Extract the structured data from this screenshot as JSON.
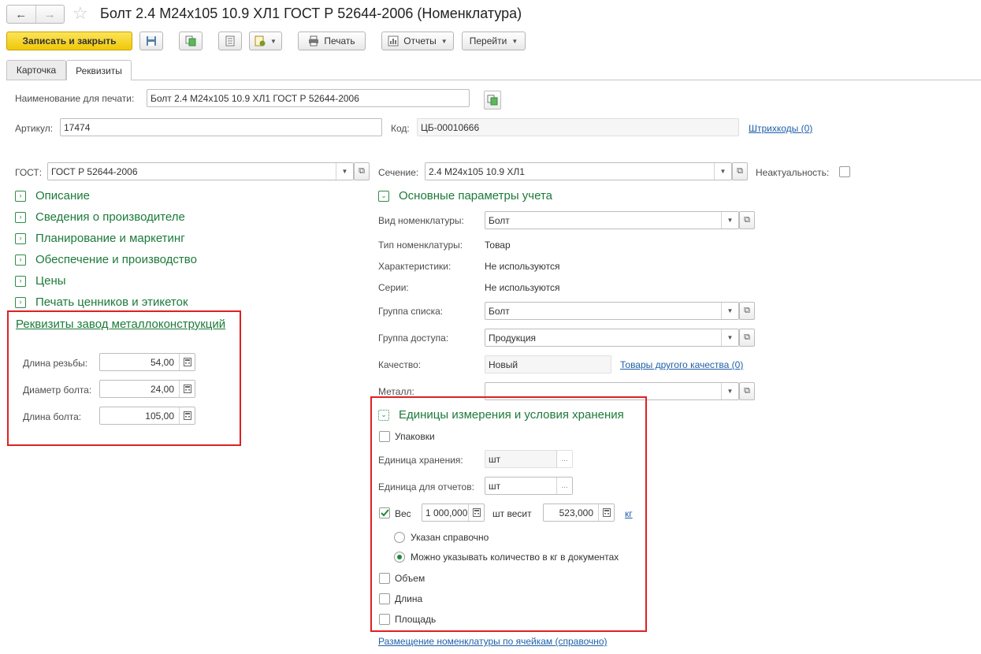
{
  "window": {
    "title": "Болт 2.4 М24х105 10.9 ХЛ1 ГОСТ Р 52644-2006 (Номенклатура)",
    "back_icon": "arrow-left-icon",
    "forward_icon": "arrow-right-icon",
    "favorite_icon": "star-icon"
  },
  "toolbar": {
    "save_close": "Записать и закрыть",
    "print": "Печать",
    "reports": "Отчеты",
    "goto": "Перейти"
  },
  "tabs": [
    "Карточка",
    "Реквизиты"
  ],
  "fields": {
    "print_name_label": "Наименование для печати:",
    "print_name_value": "Болт 2.4 М24х105 10.9 ХЛ1 ГОСТ Р 52644-2006",
    "article_label": "Артикул:",
    "article_value": "17474",
    "code_label": "Код:",
    "code_value": "ЦБ-00010666",
    "barcodes_link": "Штрихкоды (0)",
    "gost_label": "ГОСТ:",
    "gost_value": "ГОСТ Р 52644-2006",
    "section_label": "Сечение:",
    "section_value": "2.4 М24х105 10.9 ХЛ1",
    "irrelevance_label": "Неактуальность:"
  },
  "left_groups": [
    "Описание",
    "Сведения о производителе",
    "Планирование и маркетинг",
    "Обеспечение и производство",
    "Цены",
    "Печать ценников и этикеток"
  ],
  "plant_requisites": {
    "title": "Реквизиты завод металлоконструкций",
    "thread_length_label": "Длина резьбы:",
    "thread_length_value": "54,00",
    "bolt_diameter_label": "Диаметр болта:",
    "bolt_diameter_value": "24,00",
    "bolt_length_label": "Длина болта:",
    "bolt_length_value": "105,00"
  },
  "main_params": {
    "title": "Основные параметры учета",
    "kind_label": "Вид номенклатуры:",
    "kind_value": "Болт",
    "type_label": "Тип номенклатуры:",
    "type_value": "Товар",
    "characteristics_label": "Характеристики:",
    "characteristics_value": "Не используются",
    "series_label": "Серии:",
    "series_value": "Не используются",
    "list_group_label": "Группа списка:",
    "list_group_value": "Болт",
    "access_group_label": "Группа доступа:",
    "access_group_value": "Продукция",
    "quality_label": "Качество:",
    "quality_value": "Новый",
    "other_quality_link": "Товары другого качества (0)",
    "metal_label": "Металл:",
    "metal_value": ""
  },
  "units": {
    "title": "Единицы измерения и условия хранения",
    "packages_label": "Упаковки",
    "storage_unit_label": "Единица хранения:",
    "storage_unit_value": "шт",
    "report_unit_label": "Единица для отчетов:",
    "report_unit_value": "шт",
    "weight_label": "Вес",
    "weight_qty_value": "1 000,000",
    "weighs_label": "шт весит",
    "weight_value": "523,000",
    "weight_unit_link": "кг",
    "radio_reference": "Указан справочно",
    "radio_kg_docs": "Можно указывать количество в кг в документах",
    "volume_label": "Объем",
    "length_label": "Длина",
    "area_label": "Площадь"
  },
  "bottom_link": "Размещение номенклатуры по ячейкам (справочно)",
  "colors": {
    "accent_green": "#1c7a3a",
    "link_blue": "#1f5fa8",
    "highlight_red": "#e02020",
    "primary_yellow": "#f0c808"
  }
}
